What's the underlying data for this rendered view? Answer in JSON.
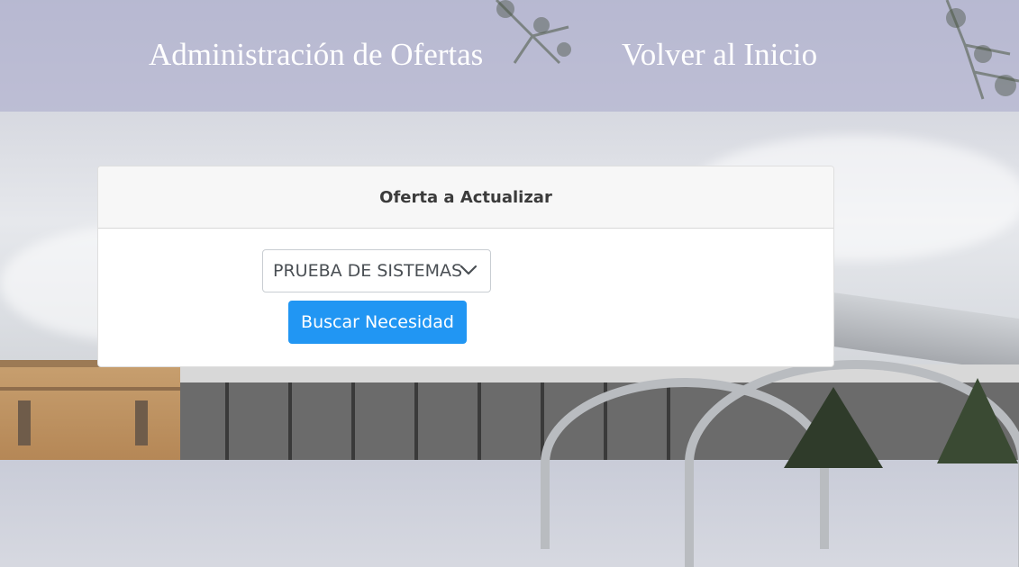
{
  "header": {
    "nav_admin_label": "Administración de Ofertas",
    "nav_home_label": "Volver al Inicio"
  },
  "card": {
    "title": "Oferta a Actualizar",
    "select_value": "PRUEBA DE SISTEMAS",
    "search_button_label": "Buscar Necesidad"
  },
  "icons": {
    "select_chevron": "chevron-down-icon"
  },
  "colors": {
    "header_overlay": "#ACACCD",
    "button_primary": "#2196F3",
    "card_header_bg": "#F7F7F7",
    "nav_text": "#FFFFFF"
  }
}
